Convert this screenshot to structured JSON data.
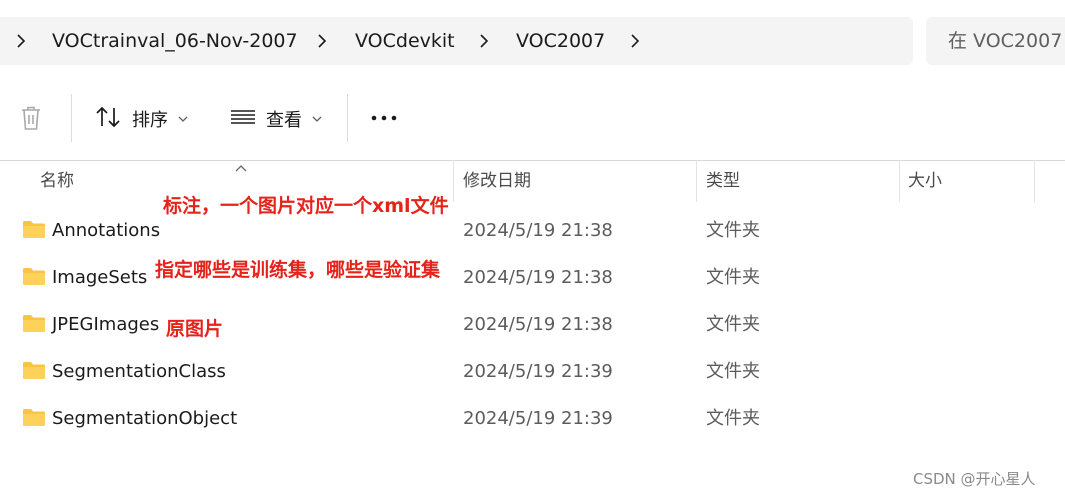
{
  "address": {
    "breadcrumbs": [
      "VOCtrainval_06-Nov-2007",
      "VOCdevkit",
      "VOC2007"
    ],
    "search_placeholder": "在 VOC2007"
  },
  "toolbar": {
    "delete_icon": "trash-icon",
    "sort_label": "排序",
    "view_label": "查看",
    "more_icon": "more-icon"
  },
  "columns": {
    "name": "名称",
    "date": "修改日期",
    "type": "类型",
    "size": "大小"
  },
  "files": [
    {
      "name": "Annotations",
      "date": "2024/5/19 21:38",
      "type": "文件夹"
    },
    {
      "name": "ImageSets",
      "date": "2024/5/19 21:38",
      "type": "文件夹"
    },
    {
      "name": "JPEGImages",
      "date": "2024/5/19 21:38",
      "type": "文件夹"
    },
    {
      "name": "SegmentationClass",
      "date": "2024/5/19 21:39",
      "type": "文件夹"
    },
    {
      "name": "SegmentationObject",
      "date": "2024/5/19 21:39",
      "type": "文件夹"
    }
  ],
  "annotations": {
    "annotations_note": "标注，一个图片对应一个xml文件",
    "imagesets_note": "指定哪些是训练集，哪些是验证集",
    "jpeg_note": "原图片"
  },
  "watermark": "CSDN @开心星人",
  "colors": {
    "annotation_red": "#e5231b",
    "folder_yellow": "#f8c542"
  }
}
